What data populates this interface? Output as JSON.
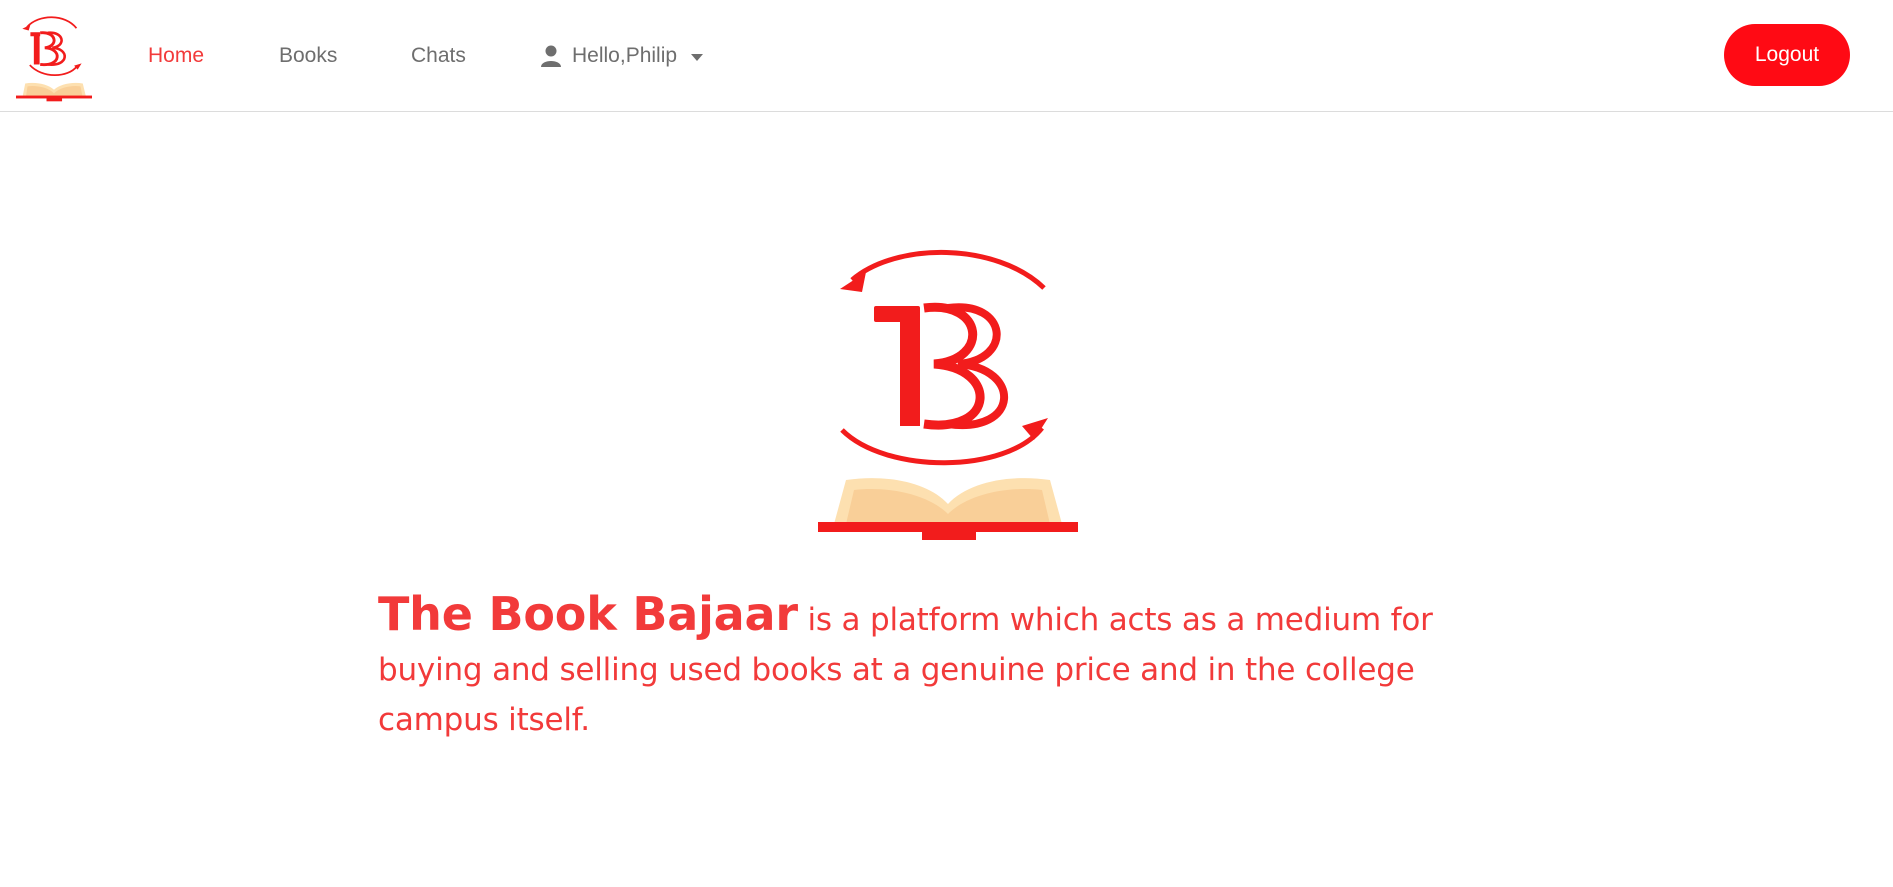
{
  "nav": {
    "logo_alt": "The Book Bajaar logo",
    "links": [
      {
        "label": "Home",
        "active": true
      },
      {
        "label": "Books",
        "active": false
      },
      {
        "label": "Chats",
        "active": false
      }
    ],
    "user_greeting": "Hello,Philip",
    "user_icon": "user-icon",
    "dropdown_icon": "caret-down-icon",
    "logout_label": "Logout"
  },
  "hero": {
    "brand_name": "The Book Bajaar",
    "description": " is a platform which acts as a medium for buying and selling used books at a genuine price and in the college campus itself."
  },
  "colors": {
    "accent": "#f23a3a",
    "logout_bg": "#ff0a14",
    "logo_red": "#f21c1c",
    "book_light": "#fde0b0",
    "book_mid": "#f9cf98",
    "nav_text": "#6e6e6e"
  }
}
